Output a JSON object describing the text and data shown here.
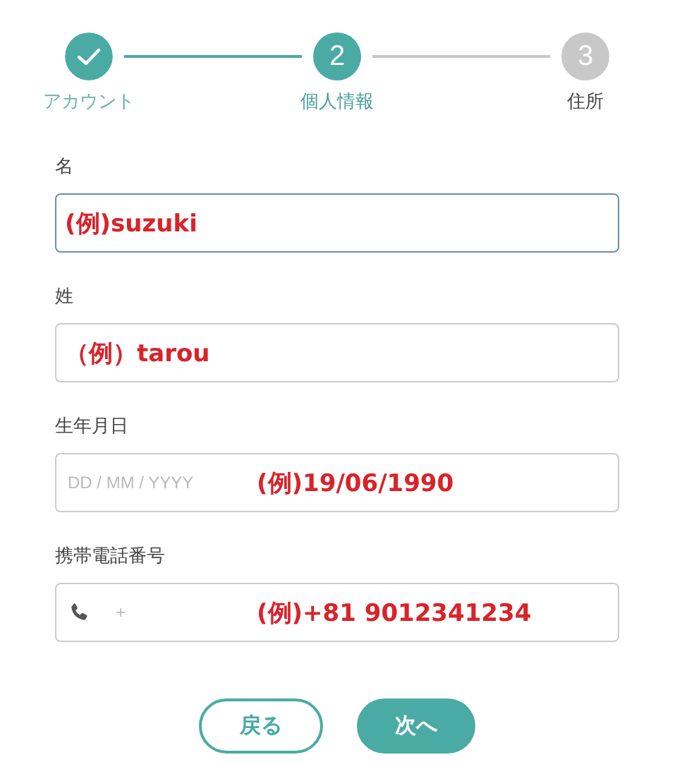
{
  "steps": [
    {
      "label": "アカウント",
      "done": true,
      "selected": false
    },
    {
      "number": "2",
      "label": "個人情報",
      "done": false,
      "selected": true
    },
    {
      "number": "3",
      "label": "住所",
      "done": false,
      "selected": false
    }
  ],
  "fields": [
    {
      "kind": "text",
      "label": "名",
      "focused": true,
      "example": "(例)suzuki"
    },
    {
      "kind": "text",
      "label": "姓",
      "focused": false,
      "example": "（例）tarou"
    },
    {
      "kind": "date",
      "label": "生年月日",
      "focused": false,
      "placeholder": "DD / MM / YYYY",
      "example": "(例)19/06/1990"
    },
    {
      "kind": "phone",
      "label": "携帯電話番号",
      "focused": false,
      "placeholder": "+",
      "example": "(例)+81 9012341234"
    }
  ],
  "buttons": [
    {
      "label": "戻る",
      "kind": "secondary"
    },
    {
      "label": "次へ",
      "kind": "primary"
    }
  ]
}
